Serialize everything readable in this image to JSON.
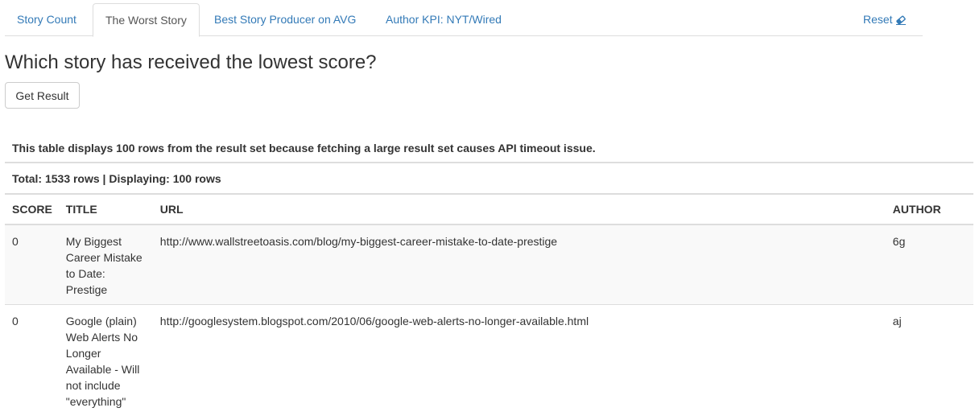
{
  "tabs": {
    "items": [
      {
        "label": "Story Count"
      },
      {
        "label": "The Worst Story"
      },
      {
        "label": "Best Story Producer on AVG"
      },
      {
        "label": "Author KPI: NYT/Wired"
      }
    ],
    "active_index": 1,
    "reset_label": "Reset",
    "reset_icon": "eraser-icon"
  },
  "question": "Which story has received the lowest score?",
  "get_result_label": "Get Result",
  "note": "This table displays 100 rows from the result set because fetching a large result set causes API timeout issue.",
  "total": "Total: 1533 rows | Displaying: 100 rows",
  "table": {
    "headers": [
      "SCORE",
      "TITLE",
      "URL",
      "AUTHOR"
    ],
    "rows": [
      {
        "score": "0",
        "title": "My Biggest Career Mistake to Date: Prestige",
        "url": "http://www.wallstreetoasis.com/blog/my-biggest-career-mistake-to-date-prestige",
        "author": "6g"
      },
      {
        "score": "0",
        "title": "Google (plain) Web Alerts No Longer Available - Will not include \"everything\"",
        "url": "http://googlesystem.blogspot.com/2010/06/google-web-alerts-no-longer-available.html",
        "author": "aj"
      }
    ]
  },
  "colors": {
    "link": "#337ab7",
    "border": "#dddddd",
    "stripe": "#f9f9f9",
    "text": "#333333"
  }
}
